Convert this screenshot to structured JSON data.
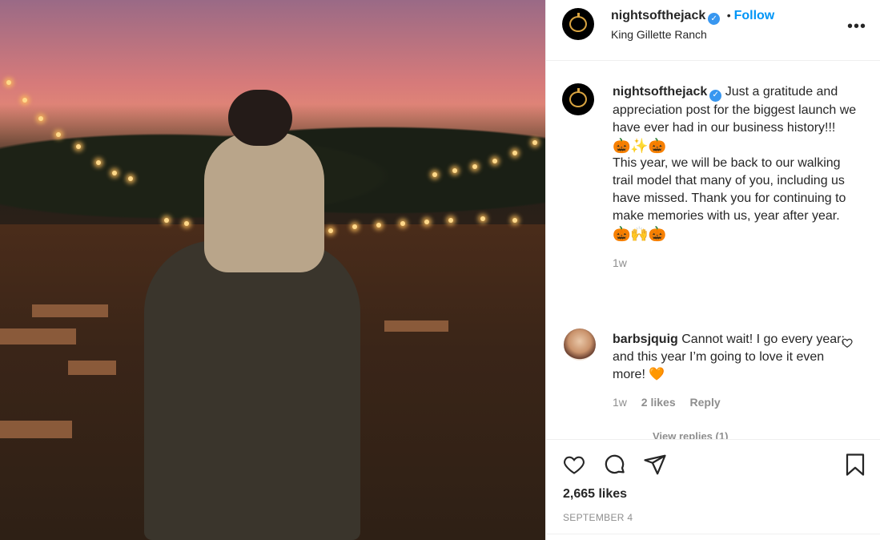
{
  "post": {
    "account": "nightsofthejack",
    "verified": true,
    "follow_separator": "•",
    "follow_label": "Follow",
    "location": "King Gillette Ranch",
    "more_label": "•••"
  },
  "caption": {
    "username": "nightsofthejack",
    "line1": "Just a gratitude and appreciation post for the biggest launch we have ever had in our business history!!!",
    "emoji1": "🎃✨🎃",
    "line2": "This year, we will be back to our walking trail model that many of you, including us have missed. Thank you for continuing to make memories with us, year after year.",
    "emoji2": "🎃🙌🎃",
    "time": "1w"
  },
  "comments": [
    {
      "username": "barbsjquig",
      "text": "Cannot wait! I go every year; and this year I’m going to love it even more! 🧡",
      "time": "1w",
      "likes": "2 likes",
      "reply_label": "Reply",
      "view_replies": "View replies (1)"
    }
  ],
  "actions": {
    "likes": "2,665 likes",
    "date": "SEPTEMBER 4"
  },
  "icons": [
    "heart-icon",
    "comment-icon",
    "share-icon",
    "bookmark-icon",
    "verified-badge-icon",
    "more-icon"
  ]
}
